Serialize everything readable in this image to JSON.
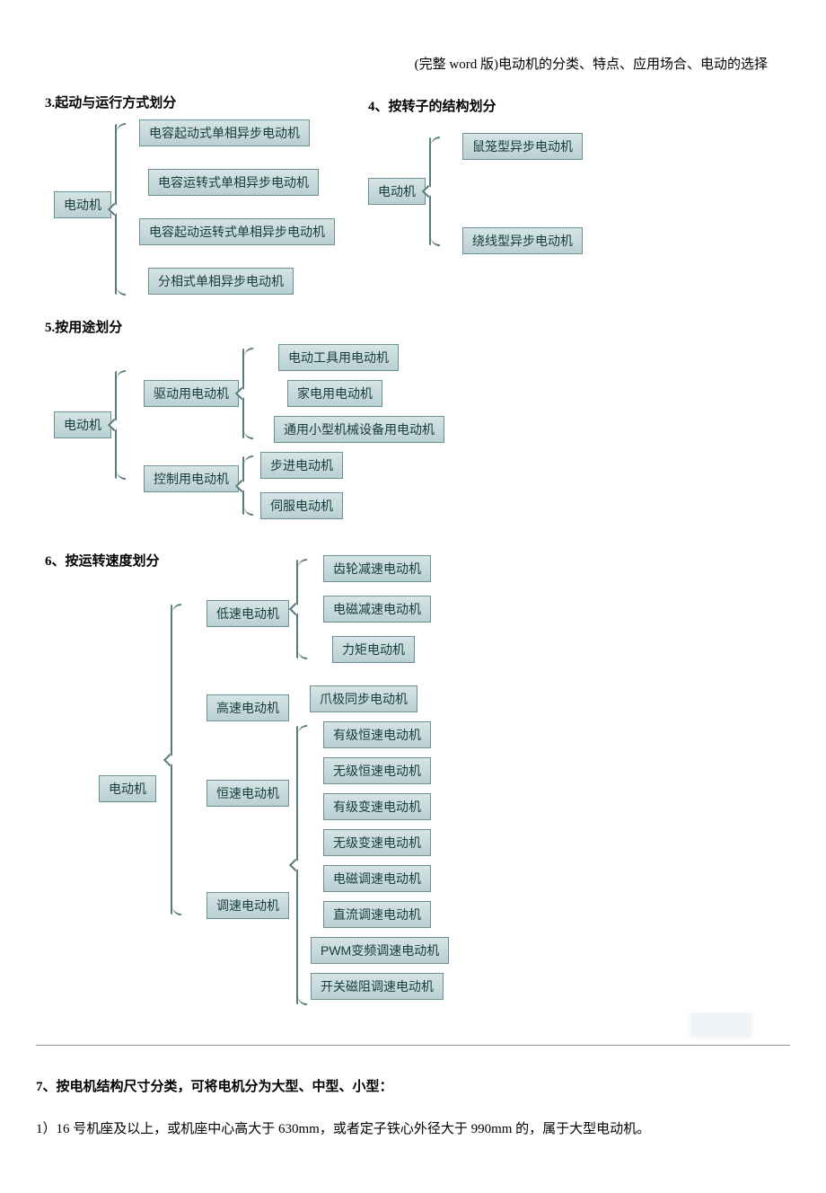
{
  "header": "(完整 word 版)电动机的分类、特点、应用场合、电动的选择",
  "sec3": {
    "title": "3.起动与运行方式划分",
    "root": "电动机",
    "items": [
      "电容起动式单相异步电动机",
      "电容运转式单相异步电动机",
      "电容起动运转式单相异步电动机",
      "分相式单相异步电动机"
    ]
  },
  "sec4": {
    "title": "4、按转子的结构划分",
    "root": "电动机",
    "items": [
      "鼠笼型异步电动机",
      "绕线型异步电动机"
    ]
  },
  "sec5": {
    "title": "5.按用途划分",
    "root": "电动机",
    "mid": [
      "驱动用电动机",
      "控制用电动机"
    ],
    "drive": [
      "电动工具用电动机",
      "家电用电动机",
      "通用小型机械设备用电动机"
    ],
    "ctrl": [
      "步进电动机",
      "伺服电动机"
    ]
  },
  "sec6": {
    "title": "6、按运转速度划分",
    "root": "电动机",
    "mid": [
      "低速电动机",
      "高速电动机",
      "恒速电动机",
      "调速电动机"
    ],
    "leaf": [
      "齿轮减速电动机",
      "电磁减速电动机",
      "力矩电动机",
      "爪极同步电动机",
      "有级恒速电动机",
      "无级恒速电动机",
      "有级变速电动机",
      "无级变速电动机",
      "电磁调速电动机",
      "直流调速电动机",
      "PWM变频调速电动机",
      "开关磁阻调速电动机"
    ]
  },
  "sec7": {
    "title": "7、按电机结构尺寸分类，可将电机分为大型、中型、小型：",
    "line1": "1）16 号机座及以上，或机座中心高大于 630mm，或者定子铁心外径大于 990mm 的，属于大型电动机。"
  }
}
